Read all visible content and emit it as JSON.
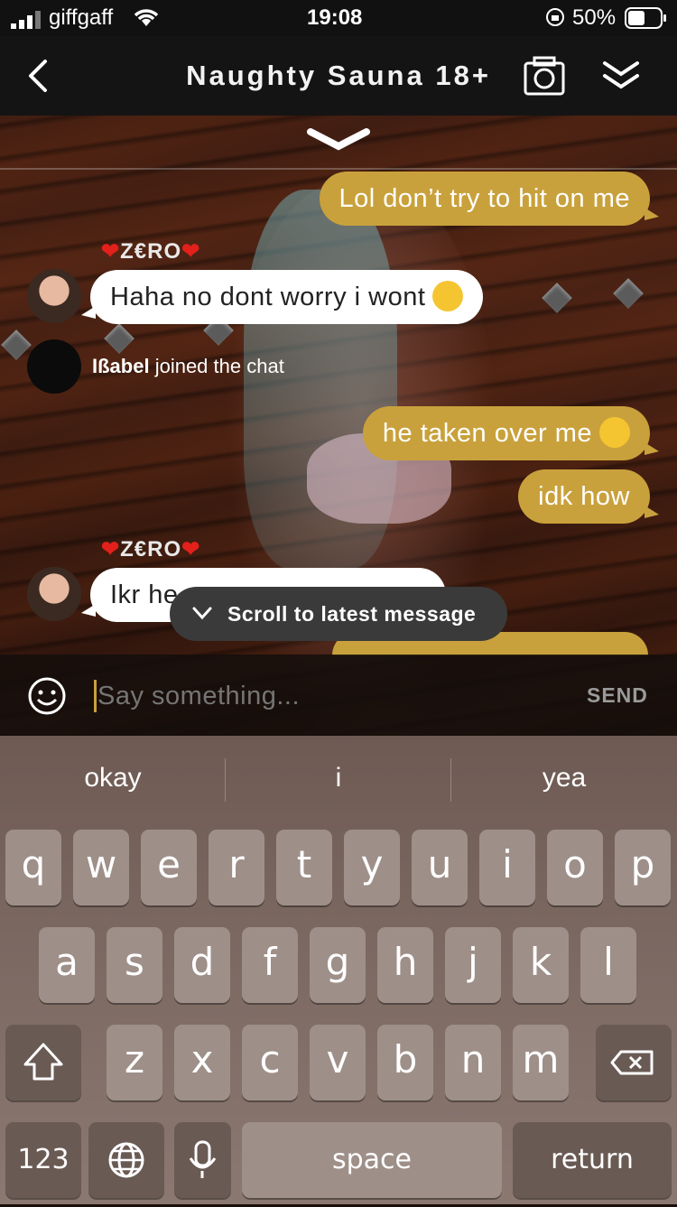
{
  "status_bar": {
    "carrier": "giffgaff",
    "time": "19:08",
    "battery": "50%"
  },
  "header": {
    "title": "Naughty Sauna 18+"
  },
  "messages": [
    {
      "type": "mine",
      "text": "Lol don’t try to hit on me"
    },
    {
      "type": "other",
      "user": "Z€RO",
      "text": "Haha no dont worry i wont"
    },
    {
      "type": "system",
      "user": "Ißabel",
      "text": "joined the chat"
    },
    {
      "type": "mine",
      "text": "he taken over me"
    },
    {
      "type": "mine",
      "text": "idk how"
    },
    {
      "type": "other",
      "user": "Z€RO",
      "text": "Ikr he"
    }
  ],
  "scroll_pill": {
    "label": "Scroll to latest message"
  },
  "composer": {
    "placeholder": "Say something...",
    "send_label": "SEND"
  },
  "keyboard": {
    "suggestions": [
      "okay",
      "i",
      "yea"
    ],
    "row1": [
      "q",
      "w",
      "e",
      "r",
      "t",
      "y",
      "u",
      "i",
      "o",
      "p"
    ],
    "row2": [
      "a",
      "s",
      "d",
      "f",
      "g",
      "h",
      "j",
      "k",
      "l"
    ],
    "row3": [
      "z",
      "x",
      "c",
      "v",
      "b",
      "n",
      "m"
    ],
    "numbers_label": "123",
    "space_label": "space",
    "return_label": "return"
  },
  "colors": {
    "accent_bubble": "#c9a13c",
    "header_bg": "#141414"
  }
}
